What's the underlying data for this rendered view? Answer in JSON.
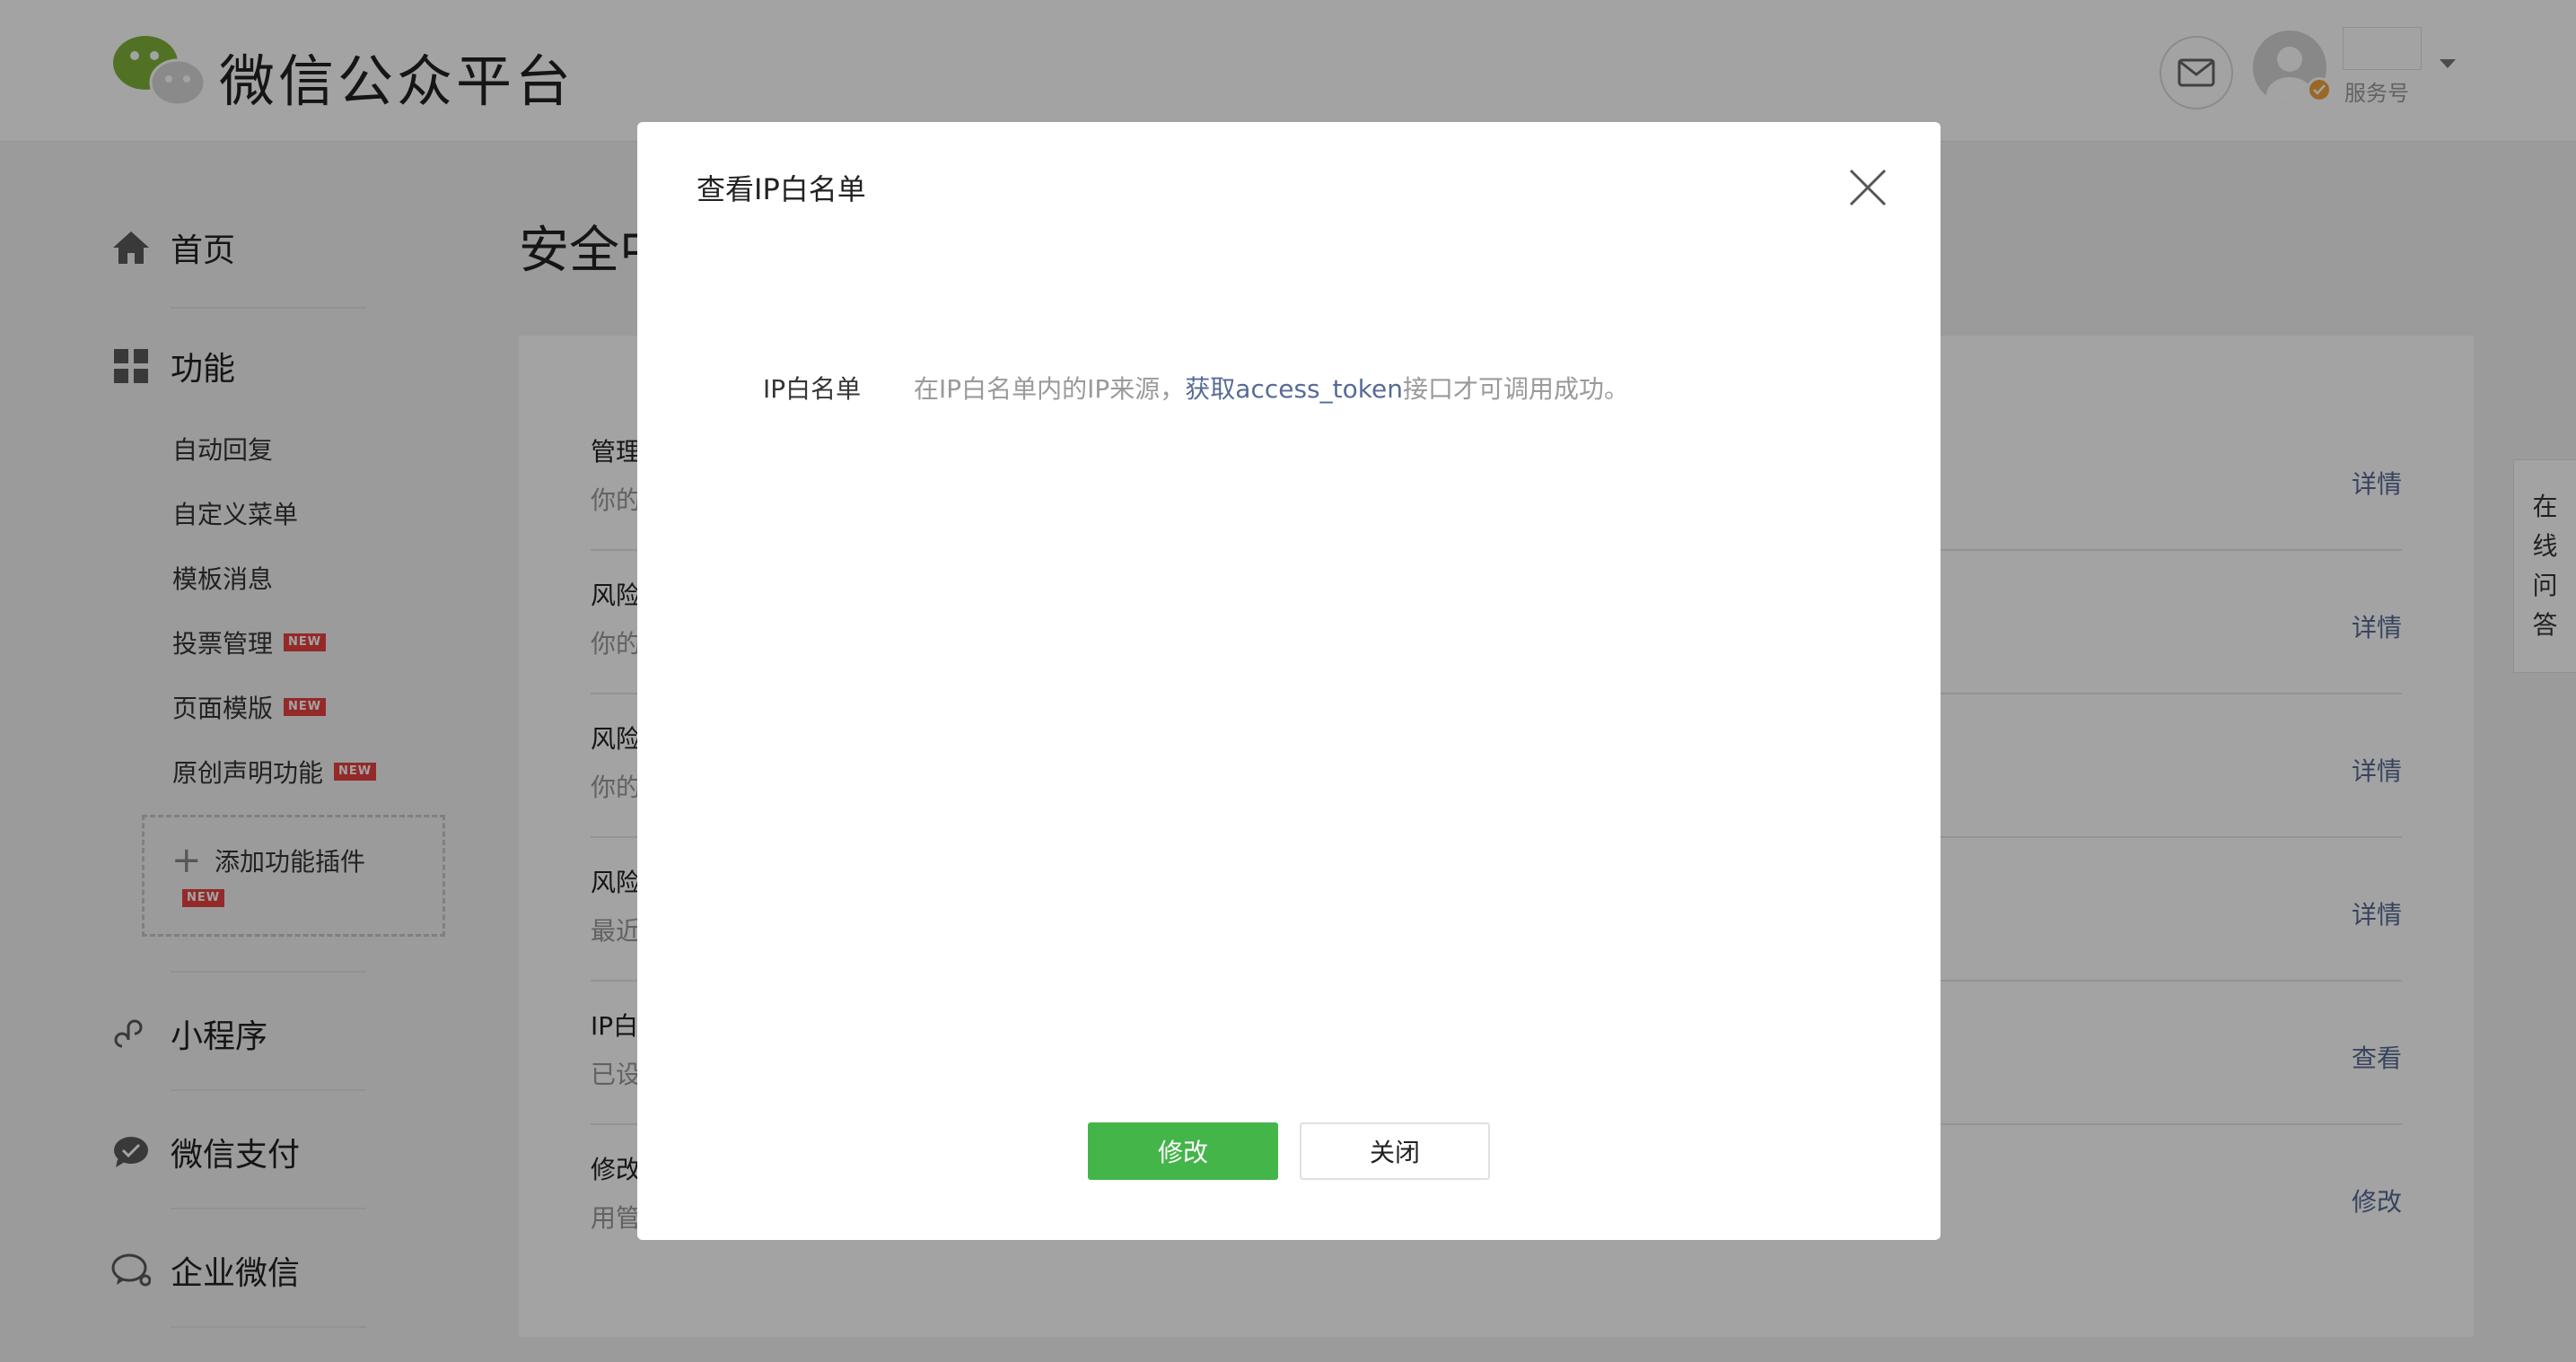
{
  "header": {
    "brand": "微信公众平台",
    "account_type": "服务号"
  },
  "sidebar": {
    "home": "首页",
    "functions": "功能",
    "function_items": [
      {
        "label": "自动回复",
        "badge": ""
      },
      {
        "label": "自定义菜单",
        "badge": ""
      },
      {
        "label": "模板消息",
        "badge": ""
      },
      {
        "label": "投票管理",
        "badge": "NEW"
      },
      {
        "label": "页面模版",
        "badge": "NEW"
      },
      {
        "label": "原创声明功能",
        "badge": "NEW"
      }
    ],
    "add_plugin": {
      "label": "添加功能插件",
      "badge": "NEW"
    },
    "mini_program": "小程序",
    "wechat_pay": "微信支付",
    "enterprise_wechat": "企业微信"
  },
  "main": {
    "page_title": "安全中",
    "rows": [
      {
        "title": "管理",
        "desc": "你的",
        "action": "详情"
      },
      {
        "title": "风险",
        "desc": "你的",
        "action": "详情"
      },
      {
        "title": "风险",
        "desc": "你的",
        "action": "详情"
      },
      {
        "title": "风险",
        "desc": "最近",
        "action": "详情"
      },
      {
        "title": "IP白",
        "desc": "已设",
        "action": "查看"
      },
      {
        "title": "修改",
        "desc": "用管",
        "action": "修改"
      }
    ]
  },
  "qa_tab": [
    "在",
    "线",
    "问",
    "答"
  ],
  "modal": {
    "title": "查看IP白名单",
    "field_label": "IP白名单",
    "tip_prefix": "在IP白名单内的IP来源，",
    "tip_link": "获取access_token",
    "tip_suffix": "接口才可调用成功。",
    "confirm_label": "修改",
    "cancel_label": "关闭"
  },
  "colors": {
    "primary_green": "#44b549",
    "link_blue": "#576b95",
    "badge_red": "#e64340",
    "mask": "rgba(0,0,0,0.36)"
  }
}
